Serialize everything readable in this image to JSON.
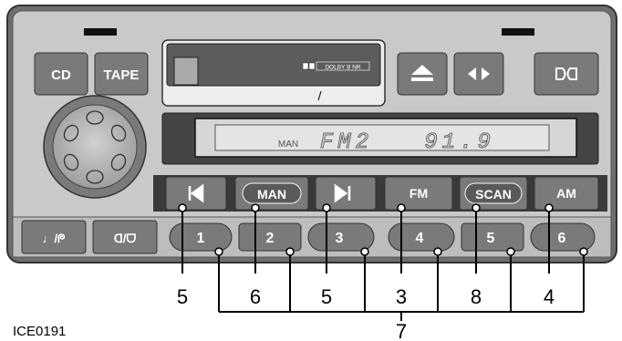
{
  "buttons": {
    "cd": "CD",
    "tape": "TAPE",
    "man": "MAN",
    "fm": "FM",
    "scan": "SCAN",
    "am": "AM",
    "mode_left": "♩/ᖘ",
    "mode_right": "ᗡ/ᗜ",
    "presets": [
      "1",
      "2",
      "3",
      "4",
      "5",
      "6"
    ]
  },
  "cassette": {
    "dolby_label": "DOLBY B NR"
  },
  "display": {
    "man_indicator": "MAN",
    "band": "FM2",
    "frequency": "91.9"
  },
  "callouts": [
    "5",
    "6",
    "5",
    "3",
    "8",
    "4",
    "7"
  ],
  "figure_code": "ICE0191"
}
